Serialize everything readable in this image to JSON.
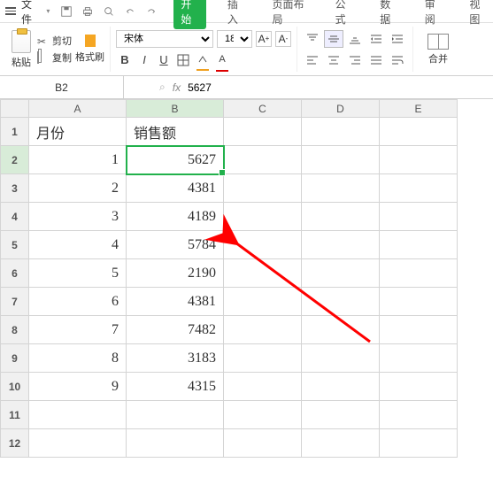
{
  "menubar": {
    "file": "文件",
    "tabs": [
      "开始",
      "插入",
      "页面布局",
      "公式",
      "数据",
      "审阅",
      "视图"
    ],
    "active_tab": 0
  },
  "ribbon": {
    "paste": "粘贴",
    "cut": "剪切",
    "copy": "复制",
    "format_painter": "格式刷",
    "font_name": "宋体",
    "font_size": "18",
    "merge": "合并"
  },
  "formula_bar": {
    "name_box": "B2",
    "fx": "fx",
    "value": "5627"
  },
  "columns": [
    "A",
    "B",
    "C",
    "D",
    "E"
  ],
  "active_col": "B",
  "active_row": 2,
  "headers": {
    "A": "月份",
    "B": "销售额"
  },
  "chart_data": {
    "type": "table",
    "title": "",
    "columns": [
      "月份",
      "销售额"
    ],
    "rows": [
      {
        "月份": 1,
        "销售额": 5627
      },
      {
        "月份": 2,
        "销售额": 4381
      },
      {
        "月份": 3,
        "销售额": 4189
      },
      {
        "月份": 4,
        "销售额": 5784
      },
      {
        "月份": 5,
        "销售额": 2190
      },
      {
        "月份": 6,
        "销售额": 4381
      },
      {
        "月份": 7,
        "销售额": 7482
      },
      {
        "月份": 8,
        "销售额": 3183
      },
      {
        "月份": 9,
        "销售额": 4315
      }
    ]
  }
}
